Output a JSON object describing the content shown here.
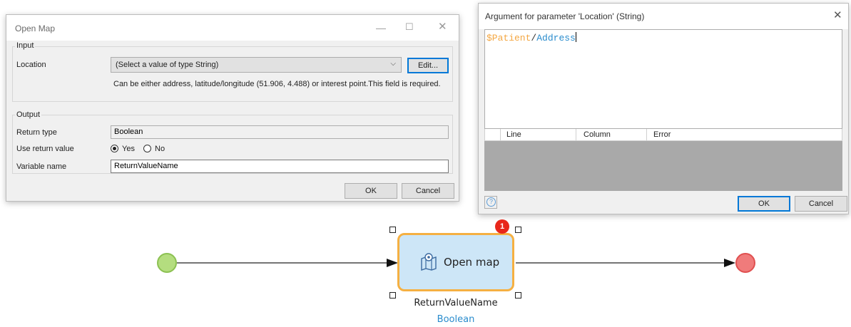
{
  "open_map_dialog": {
    "title": "Open Map",
    "input_group": "Input",
    "location_label": "Location",
    "location_value": "(Select a value of type String)",
    "edit_button": "Edit...",
    "hint": "Can be either address, latitude/longitude (51.906, 4.488) or interest point.This field is required.",
    "output_group": "Output",
    "return_type_label": "Return type",
    "return_type_value": "Boolean",
    "use_return_label": "Use return value",
    "yes_label": "Yes",
    "no_label": "No",
    "use_return_selected": "Yes",
    "variable_name_label": "Variable name",
    "variable_name_value": "ReturnValueName",
    "ok_button": "OK",
    "cancel_button": "Cancel"
  },
  "argument_dialog": {
    "title": "Argument for parameter 'Location' (String)",
    "expression": {
      "variable": "$Patient",
      "separator": "/",
      "attribute": "Address"
    },
    "columns": [
      "Line",
      "Column",
      "Error"
    ],
    "ok_button": "OK",
    "cancel_button": "Cancel"
  },
  "flow": {
    "action_label": "Open map",
    "badge_count": "1",
    "output_variable": "ReturnValueName",
    "output_type": "Boolean",
    "colors": {
      "start_event": "#b4dd7f",
      "end_event": "#f07b7b",
      "activity_fill": "#cde6f7",
      "activity_border": "#f5b042",
      "badge": "#e8271b",
      "type_text": "#2a8ccd"
    }
  }
}
